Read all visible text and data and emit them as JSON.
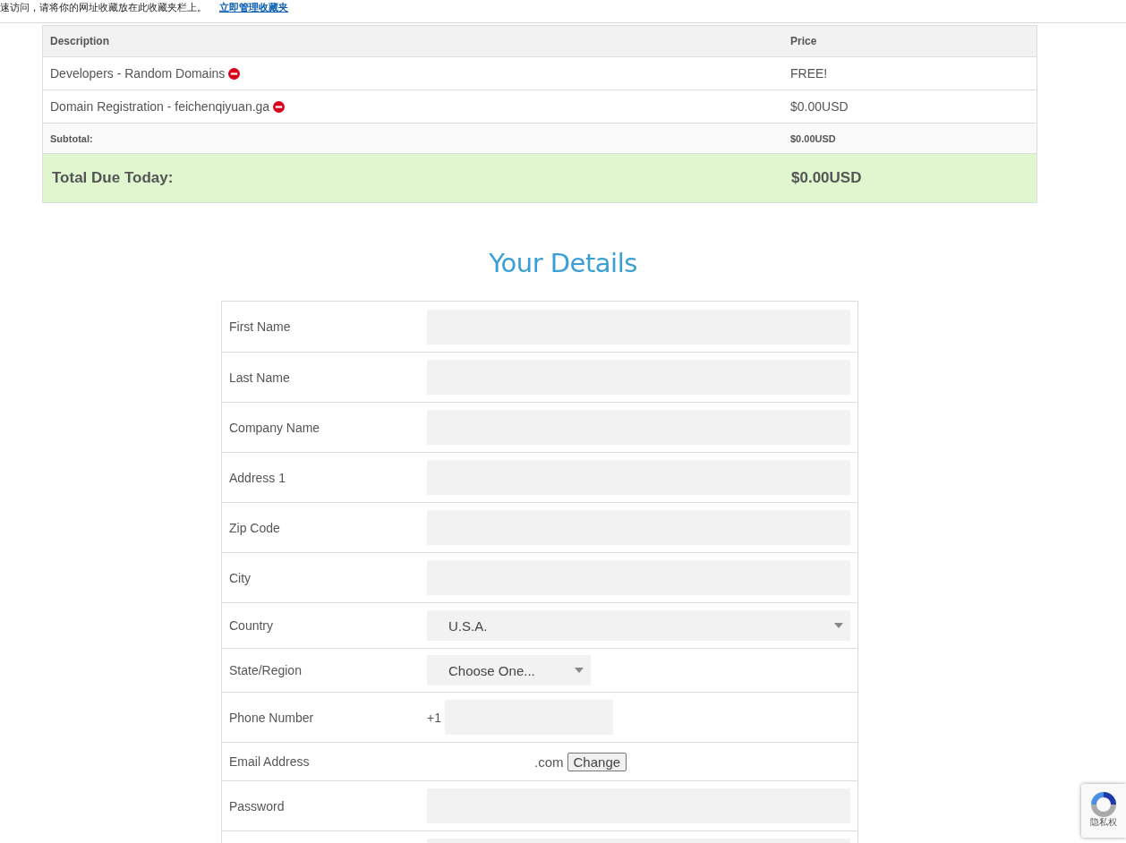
{
  "favorites_bar": {
    "message": "速访问，请将你的网址收藏放在此收藏夹栏上。",
    "link": "立即管理收藏夹"
  },
  "order_table": {
    "columns": [
      "Description",
      "Price"
    ],
    "items": [
      {
        "description": "Developers - Random Domains",
        "price": "FREE!"
      },
      {
        "description": "Domain Registration - feichenqiyuan.ga",
        "price": "$0.00USD"
      }
    ],
    "subtotal": {
      "label": "Subtotal:",
      "value": "$0.00USD"
    },
    "total": {
      "label": "Total Due Today:",
      "value": "$0.00USD"
    }
  },
  "details": {
    "title": "Your Details",
    "fields": [
      {
        "kind": "text",
        "label": "First Name"
      },
      {
        "kind": "text",
        "label": "Last Name"
      },
      {
        "kind": "text",
        "label": "Company Name"
      },
      {
        "kind": "text",
        "label": "Address 1"
      },
      {
        "kind": "text",
        "label": "Zip Code"
      },
      {
        "kind": "text",
        "label": "City"
      },
      {
        "kind": "select",
        "label": "Country",
        "value": "U.S.A.",
        "wide": true
      },
      {
        "kind": "select",
        "label": "State/Region",
        "value": "Choose One...",
        "wide": false
      },
      {
        "kind": "phone",
        "label": "Phone Number",
        "prefix": "+1"
      },
      {
        "kind": "email",
        "label": "Email Address",
        "value": ".com",
        "button": "Change"
      },
      {
        "kind": "text",
        "label": "Password"
      },
      {
        "kind": "text"
      }
    ]
  },
  "recaptcha_badge": {
    "text": "隐私权"
  }
}
